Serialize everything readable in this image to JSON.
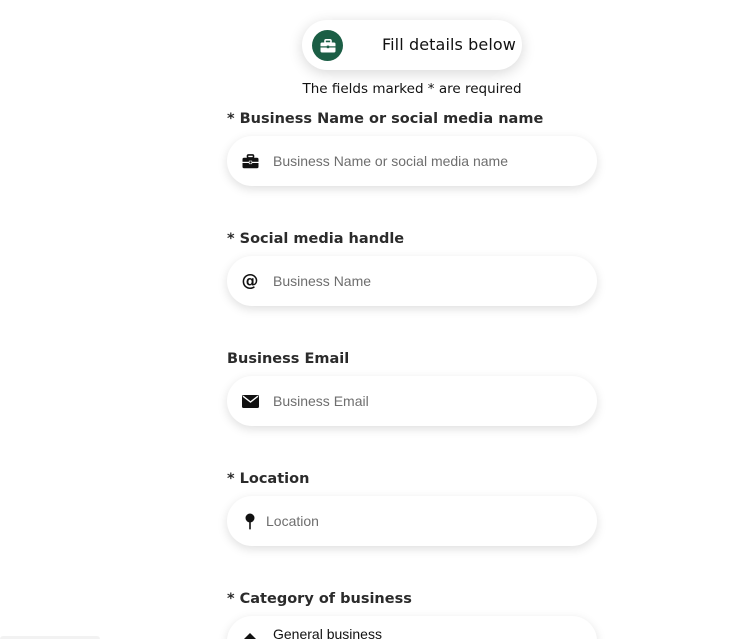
{
  "header": {
    "title": "Fill details below",
    "icon": "briefcase-icon",
    "icon_bg_color": "#1b5e45"
  },
  "required_note": "The fields marked * are required",
  "fields": {
    "business_name": {
      "label": "* Business Name or social media name",
      "placeholder": "Business Name or social media name",
      "icon": "briefcase-icon"
    },
    "social_handle": {
      "label": "* Social media handle",
      "placeholder": "Business Name",
      "icon": "at-icon"
    },
    "business_email": {
      "label": "Business Email",
      "placeholder": "Business Email",
      "icon": "envelope-icon"
    },
    "location": {
      "label": "* Location",
      "placeholder": "Location",
      "icon": "map-pin-icon"
    },
    "category": {
      "label": "* Category of business",
      "value": "General business",
      "icon": "tag-icon"
    }
  }
}
